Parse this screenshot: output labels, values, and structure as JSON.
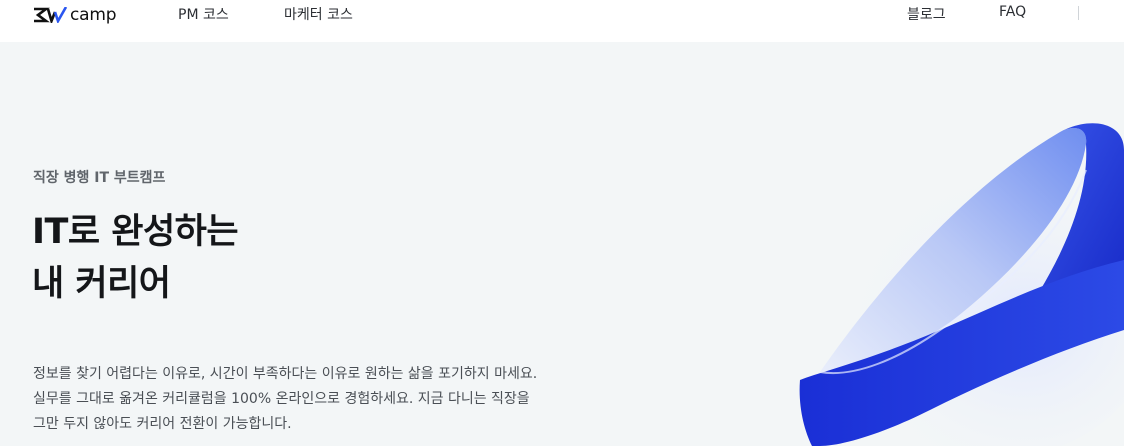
{
  "header": {
    "logo_text": "camp",
    "logo_mark": "SW",
    "nav_left": [
      {
        "label": "PM 코스"
      },
      {
        "label": "마케터 코스"
      }
    ],
    "nav_right": [
      {
        "label": "블로그"
      },
      {
        "label": "FAQ"
      }
    ]
  },
  "hero": {
    "eyebrow": "직장 병행 IT 부트캠프",
    "title_lines": [
      "IT로 완성하는",
      "내 커리어"
    ],
    "description_lines": [
      "정보를 찾기 어렵다는 이유로, 시간이 부족하다는 이유로 원하는 삶을 포기하지 마세요.",
      "실무를 그대로 옮겨온 커리큘럼을 100% 온라인으로 경험하세요. 지금 다니는 직장을",
      "그만 두지 않아도 커리어 전환이 가능합니다."
    ],
    "graphic": "blue-ribbon-3d-illustration"
  },
  "colors": {
    "background": "#f3f6f7",
    "header": "#ffffff",
    "ribbon_dark": "#1a2fd6",
    "ribbon_light": "#a9bdf7"
  }
}
